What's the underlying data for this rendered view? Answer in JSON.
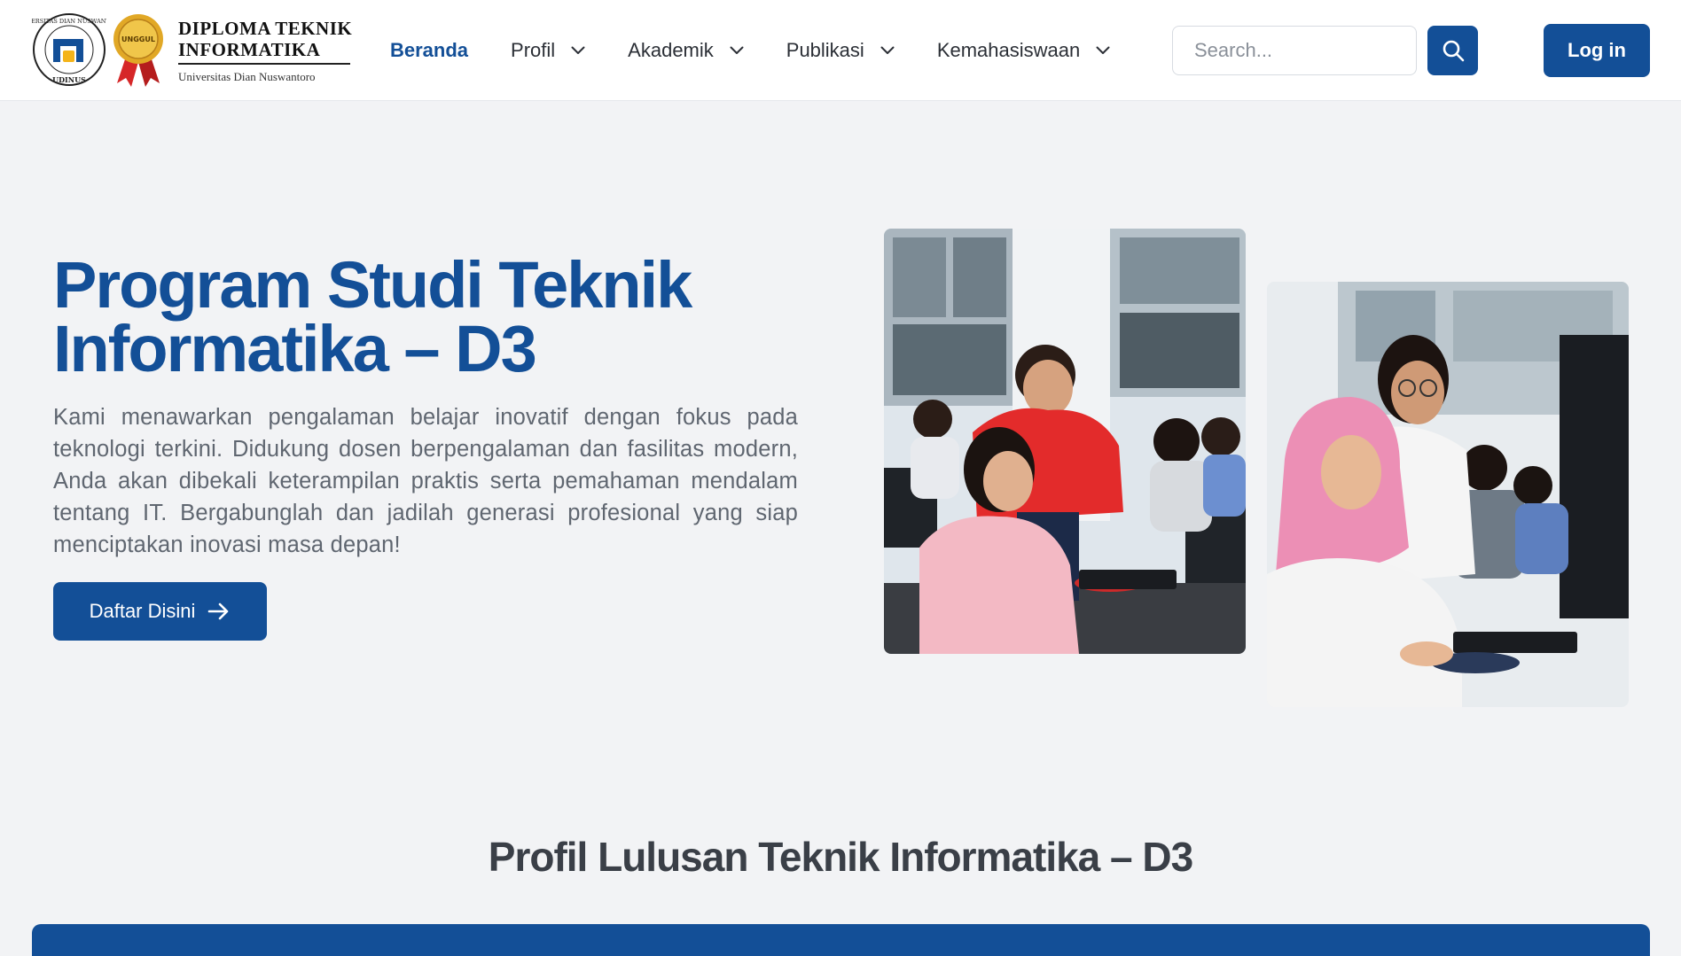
{
  "brand": {
    "line1": "DIPLOMA TEKNIK",
    "line2": "INFORMATIKA",
    "subtitle": "Universitas Dian Nuswantoro",
    "seal_text_top": "UNIVERSITAS DIAN NUSWANTORO",
    "seal_text_bottom": "UDINUS",
    "medal_text": "UNGGUL"
  },
  "nav": {
    "items": [
      {
        "label": "Beranda",
        "active": true
      },
      {
        "label": "Profil",
        "dropdown": true
      },
      {
        "label": "Akademik",
        "dropdown": true
      },
      {
        "label": "Publikasi",
        "dropdown": true
      },
      {
        "label": "Kemahasiswaan",
        "dropdown": true
      }
    ]
  },
  "search": {
    "placeholder": "Search..."
  },
  "auth": {
    "login_label": "Log in"
  },
  "hero": {
    "title_line1": "Program Studi Teknik",
    "title_line2": "Informatika – D3",
    "description": "Kami menawarkan pengalaman belajar inovatif dengan fokus pada teknologi terkini. Didukung dosen berpengalaman dan fasilitas modern, Anda akan dibekali keterampilan praktis serta pemahaman mendalam tentang IT. Bergabunglah dan jadilah generasi profesional yang siap menciptakan inovasi masa depan!",
    "cta_label": "Daftar Disini"
  },
  "section": {
    "title": "Profil Lulusan Teknik Informatika – D3"
  },
  "colors": {
    "primary": "#134f97",
    "page_bg": "#f2f3f5",
    "text_muted": "#5f6670",
    "heading_dark": "#3a3f47"
  },
  "icons": {
    "search": "search-icon",
    "chevron": "chevron-down-icon",
    "arrow": "arrow-right-icon"
  }
}
